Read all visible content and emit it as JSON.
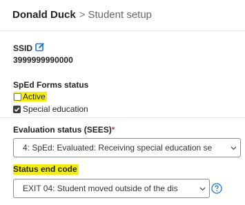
{
  "breadcrumb": {
    "student_name": "Donald Duck",
    "separator": ">",
    "page": "Student setup"
  },
  "ssid": {
    "label": "SSID",
    "value": "3999999990000",
    "edit_icon": "edit-icon"
  },
  "sped_forms": {
    "label": "SpEd Forms status",
    "options": [
      {
        "label": "Active",
        "checked": false,
        "highlighted": true
      },
      {
        "label": "Special education",
        "checked": true,
        "highlighted": false
      }
    ]
  },
  "evaluation": {
    "label": "Evaluation status (SEES)",
    "required_marker": "*",
    "selected_value": "4: SpEd: Evaluated: Receiving special education se"
  },
  "status_end_code": {
    "label": "Status end code",
    "selected_value": "EXIT 04: Student moved outside of the dis",
    "help_icon": "help-circle-icon"
  },
  "colors": {
    "accent": "#1a73e8",
    "highlight": "#f6f000",
    "required": "#d13438"
  }
}
